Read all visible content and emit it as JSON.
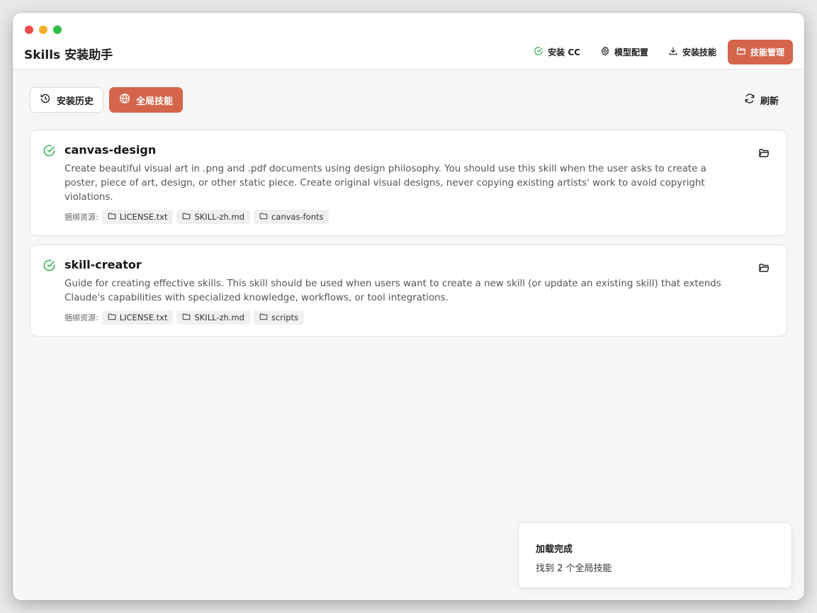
{
  "app": {
    "title": "Skills 安装助手"
  },
  "colors": {
    "accent": "#d4654a",
    "success": "#3ab55a"
  },
  "nav": {
    "items": [
      {
        "label": "安装 CC",
        "icon": "check-circle-icon"
      },
      {
        "label": "模型配置",
        "icon": "gear-icon"
      },
      {
        "label": "安装技能",
        "icon": "download-icon"
      },
      {
        "label": "技能管理",
        "icon": "folder-icon",
        "active": true
      }
    ]
  },
  "toolbar": {
    "history_label": "安装历史",
    "global_label": "全局技能",
    "refresh_label": "刷新"
  },
  "skills": [
    {
      "name": "canvas-design",
      "description": "Create beautiful visual art in .png and .pdf documents using design philosophy. You should use this skill when the user asks to create a poster, piece of art, design, or other static piece. Create original visual designs, never copying existing artists' work to avoid copyright violations.",
      "resources_label": "捆绑资源:",
      "resources": [
        "LICENSE.txt",
        "SKILL-zh.md",
        "canvas-fonts"
      ]
    },
    {
      "name": "skill-creator",
      "description": "Guide for creating effective skills. This skill should be used when users want to create a new skill (or update an existing skill) that extends Claude's capabilities with specialized knowledge, workflows, or tool integrations.",
      "resources_label": "捆绑资源:",
      "resources": [
        "LICENSE.txt",
        "SKILL-zh.md",
        "scripts"
      ]
    }
  ],
  "toast": {
    "title": "加载完成",
    "message": "找到 2 个全局技能"
  }
}
